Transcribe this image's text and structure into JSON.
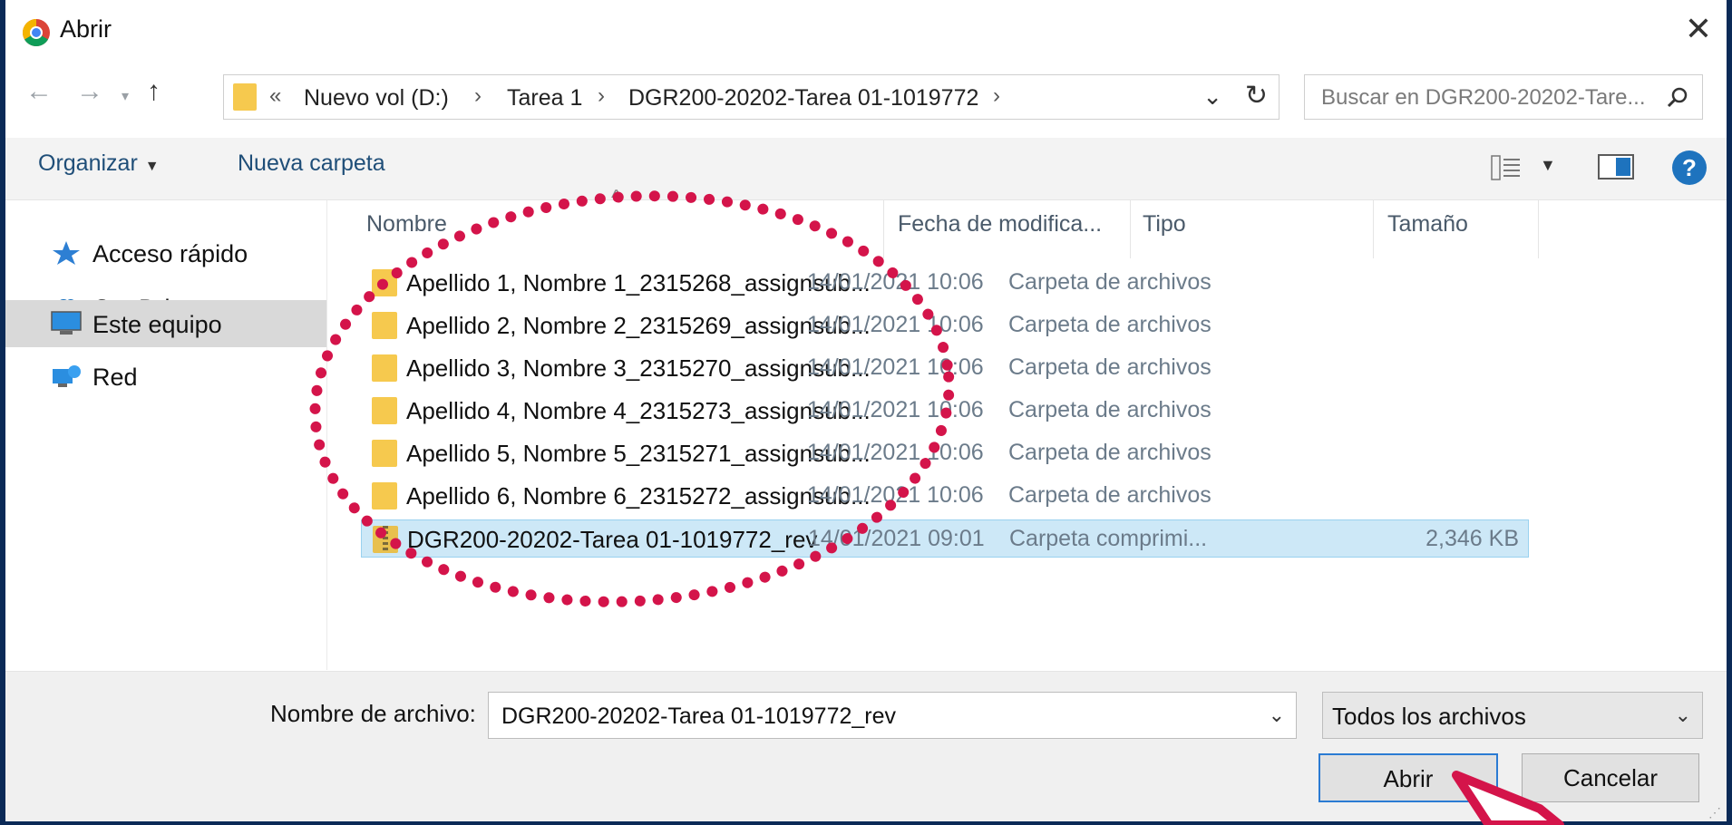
{
  "window": {
    "title": "Abrir",
    "close_glyph": "✕"
  },
  "address": {
    "overflow": "«",
    "crumbs": [
      "Nuevo vol (D:)",
      "Tarea 1",
      "DGR200-20202-Tarea 01-1019772"
    ],
    "sep": "›"
  },
  "search": {
    "placeholder": "Buscar en DGR200-20202-Tare..."
  },
  "toolbar": {
    "organize": "Organizar",
    "new_folder": "Nueva carpeta"
  },
  "sidebar": {
    "items": [
      {
        "label": "Acceso rápido",
        "icon": "star-icon"
      },
      {
        "label": "OneDrive",
        "icon": "cloud-icon"
      },
      {
        "label": "Este equipo",
        "icon": "computer-icon"
      },
      {
        "label": "Red",
        "icon": "network-icon"
      }
    ]
  },
  "columns": {
    "name": "Nombre",
    "date": "Fecha de modifica...",
    "type": "Tipo",
    "size": "Tamaño"
  },
  "files": [
    {
      "name": "Apellido 1, Nombre 1_2315268_assignsub...",
      "date": "14/01/2021 10:06",
      "type": "Carpeta de archivos",
      "size": ""
    },
    {
      "name": "Apellido 2, Nombre 2_2315269_assignsub...",
      "date": "14/01/2021 10:06",
      "type": "Carpeta de archivos",
      "size": ""
    },
    {
      "name": "Apellido 3, Nombre 3_2315270_assignsub...",
      "date": "14/01/2021 10:06",
      "type": "Carpeta de archivos",
      "size": ""
    },
    {
      "name": "Apellido 4, Nombre 4_2315273_assignsub...",
      "date": "14/01/2021 10:06",
      "type": "Carpeta de archivos",
      "size": ""
    },
    {
      "name": "Apellido 5, Nombre 5_2315271_assignsub...",
      "date": "14/01/2021 10:06",
      "type": "Carpeta de archivos",
      "size": ""
    },
    {
      "name": "Apellido 6, Nombre 6_2315272_assignsub...",
      "date": "14/01/2021 10:06",
      "type": "Carpeta de archivos",
      "size": ""
    },
    {
      "name": "DGR200-20202-Tarea 01-1019772_rev",
      "date": "14/01/2021 09:01",
      "type": "Carpeta comprimi...",
      "size": "2,346 KB"
    }
  ],
  "footer": {
    "filename_label": "Nombre de archivo:",
    "filename_value": "DGR200-20202-Tarea 01-1019772_rev",
    "filetype": "Todos los archivos",
    "open": "Abrir",
    "cancel": "Cancelar"
  },
  "colors": {
    "selection": "#cde8f7",
    "annotation": "#d4144a",
    "frame": "#0b2a57"
  }
}
